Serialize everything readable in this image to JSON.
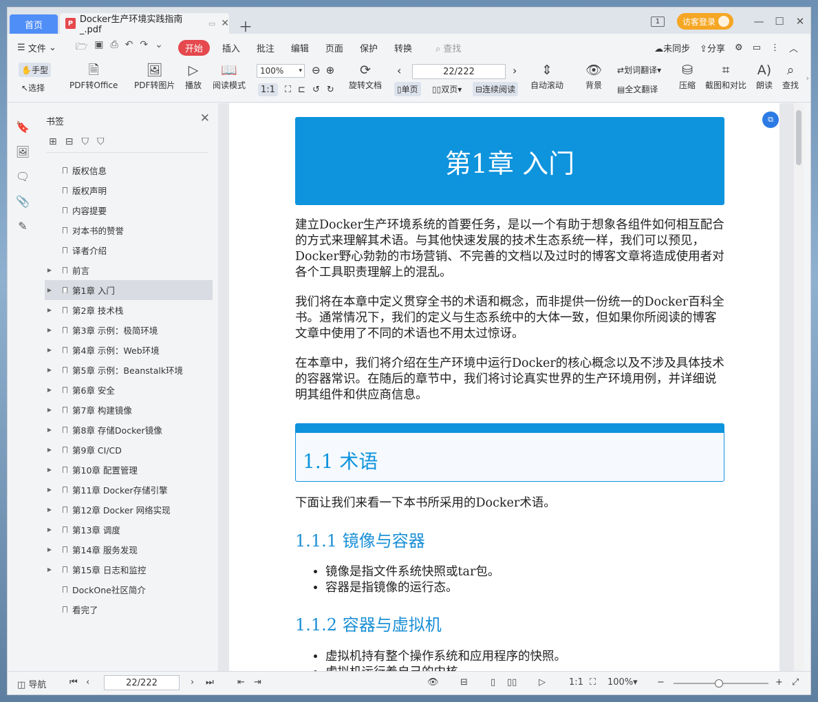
{
  "tabs": {
    "home": "首页",
    "doc_title": "Docker生产环境实践指南_.pdf",
    "pdf_icon": "P",
    "page_indicator": "1",
    "login": "访客登录"
  },
  "menu": {
    "file": "文件",
    "items": [
      "开始",
      "插入",
      "批注",
      "编辑",
      "页面",
      "保护",
      "转换"
    ],
    "search": "查找",
    "sync": "未同步",
    "share": "分享"
  },
  "toolbar": {
    "hand": "手型",
    "select": "选择",
    "pdf_to_office": "PDF转Office",
    "pdf_to_image": "PDF转图片",
    "play": "播放",
    "read_mode": "阅读模式",
    "zoom": "100%",
    "rotate": "旋转文档",
    "page": "22/222",
    "single": "单页",
    "double": "双页",
    "continuous": "连续阅读",
    "auto_scroll": "自动滚动",
    "background": "背景",
    "word_translate": "划词翻译",
    "full_translate": "全文翻译",
    "compress": "压缩",
    "screenshot_compare": "截图和对比",
    "read_aloud": "朗读",
    "find": "查找"
  },
  "panel": {
    "title": "书签",
    "bookmarks": [
      {
        "label": "版权信息",
        "expandable": false
      },
      {
        "label": "版权声明",
        "expandable": false
      },
      {
        "label": "内容提要",
        "expandable": false
      },
      {
        "label": "对本书的赞誉",
        "expandable": false
      },
      {
        "label": "译者介绍",
        "expandable": false
      },
      {
        "label": "前言",
        "expandable": true
      },
      {
        "label": "第1章 入门",
        "expandable": true,
        "selected": true
      },
      {
        "label": "第2章 技术栈",
        "expandable": true
      },
      {
        "label": "第3章 示例：极简环境",
        "expandable": true
      },
      {
        "label": "第4章 示例：Web环境",
        "expandable": true
      },
      {
        "label": "第5章 示例：Beanstalk环境",
        "expandable": true
      },
      {
        "label": "第6章 安全",
        "expandable": true
      },
      {
        "label": "第7章 构建镜像",
        "expandable": true
      },
      {
        "label": "第8章 存储Docker镜像",
        "expandable": true
      },
      {
        "label": "第9章 CI/CD",
        "expandable": true
      },
      {
        "label": "第10章 配置管理",
        "expandable": true
      },
      {
        "label": "第11章 Docker存储引擎",
        "expandable": true
      },
      {
        "label": "第12章 Docker 网络实现",
        "expandable": true
      },
      {
        "label": "第13章 调度",
        "expandable": true
      },
      {
        "label": "第14章 服务发现",
        "expandable": true
      },
      {
        "label": "第15章 日志和监控",
        "expandable": true
      },
      {
        "label": "DockOne社区简介",
        "expandable": false
      },
      {
        "label": "看完了",
        "expandable": false
      }
    ]
  },
  "document": {
    "chapter_num": "第1章 入门",
    "p1": "建立Docker生产环境系统的首要任务，是以一个有助于想象各组件如何相互配合的方式来理解其术语。与其他快速发展的技术生态系统一样，我们可以预见，Docker野心勃勃的市场营销、不完善的文档以及过时的博客文章将造成使用者对各个工具职责理解上的混乱。",
    "p2": "我们将在本章中定义贯穿全书的术语和概念，而非提供一份统一的Docker百科全书。通常情况下，我们的定义与生态系统中的大体一致，但如果你所阅读的博客文章中使用了不同的术语也不用太过惊讶。",
    "p3": "在本章中，我们将介绍在生产环境中运行Docker的核心概念以及不涉及具体技术的容器常识。在随后的章节中，我们将讨论真实世界的生产环境用例，并详细说明其组件和供应商信息。",
    "section": "1.1 术语",
    "p4": "下面让我们来看一下本书所采用的Docker术语。",
    "sub1": "1.1.1 镜像与容器",
    "bullets1": [
      "镜像是指文件系统快照或tar包。",
      "容器是指镜像的运行态。"
    ],
    "sub2": "1.1.2 容器与虚拟机",
    "bullets2": [
      "虚拟机持有整个操作系统和应用程序的快照。",
      "虚拟机运行着自己的内核。"
    ]
  },
  "statusbar": {
    "nav": "导航",
    "page": "22/222",
    "zoom": "100%"
  },
  "colors": {
    "accent": "#0e93dd",
    "home_tab": "#4f8ef7",
    "start_pill": "#e5484d",
    "login": "#f5a623"
  }
}
